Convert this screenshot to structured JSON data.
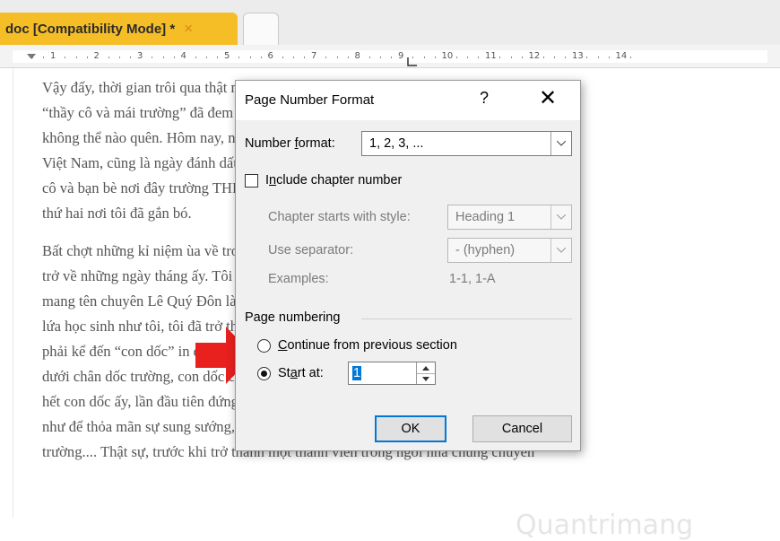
{
  "tab": {
    "title": "doc [Compatibility Mode] *",
    "close_icon": "×"
  },
  "ruler": {
    "numbers": [
      "1",
      "2",
      "3",
      "4",
      "5",
      "6",
      "7",
      "8",
      "9",
      "10",
      "11",
      "12",
      "13",
      "14"
    ]
  },
  "document": {
    "lines": [
      "Vậy đấy, thời gian trôi qua thật nhanh, những tháng ngày và những tháng qua gắn bó với",
      "“thầy cô và mái trường” đã đem lại cho tôi biết bao những kỉ niệm của một thời",
      "không thể nào quên. Hôm nay, nhân dịp kỉ niệm ngày 20/11- ngày Nhà Giáo",
      "Việt Nam, cũng là ngày đánh dấu những năm tôi học bên mái trường, thầy",
      "cô và bạn bè nơi đây trường THPT Chuyên Lê Quý Đôn – ngôi nhà",
      "thứ hai nơi tôi đã gắn bó."
    ],
    "lines2": [
      "Bất chợt những kỉ niệm ùa về trong tôi, rõ nét hơn bao giờ hết đưa tôi",
      "trở về những ngày tháng ấy. Tôi vẫn nhớ như in cái ngày nào ngôi trường",
      "mang tên chuyên Lê Quý Đôn là nơi ấp ủ những ước mơ, mong ước của biết bao",
      "lứa học sinh như tôi, tôi đã trở thành học sinh trường Chuyên Lê Quý Đôn này",
      "phải kể đến “con dốc” in đậm trong tâm trí tôi, ngay trước mắt. Biết bao lần đứng",
      "dưới chân dốc trường, con dốc cao ngất ngưởng hiện ra trước mắt tôi. Leo lên",
      "hết con dốc ấy, lần đầu tiên đứng ở cổng trường học mình vào trường, tôi đã hét thật to",
      "như để thỏa mãn sự sung sướng, thích thú xen lẫn tò mò của bản thân mình về",
      "trường.... Thật sự, trước khi trở thành một thành viên trong ngôi nhà chung chuyên"
    ]
  },
  "dialog": {
    "title": "Page Number Format",
    "help": "?",
    "close": "✕",
    "number_format_label": "Number format:",
    "number_format_value": "1, 2, 3, ...",
    "include_chapter_label": "Include chapter number",
    "chapter_style_label": "Chapter starts with style:",
    "chapter_style_value": "Heading 1",
    "separator_label": "Use separator:",
    "separator_value": "-   (hyphen)",
    "examples_label": "Examples:",
    "examples_value": "1-1, 1-A",
    "page_numbering_label": "Page numbering",
    "continue_label": "Continue from previous section",
    "start_at_label": "Start at:",
    "start_at_value": "1",
    "ok": "OK",
    "cancel": "Cancel"
  },
  "colors": {
    "tab": "#f5bd26",
    "arrow": "#e8201e",
    "focus": "#0078d7"
  },
  "watermark": "Quantrimang"
}
